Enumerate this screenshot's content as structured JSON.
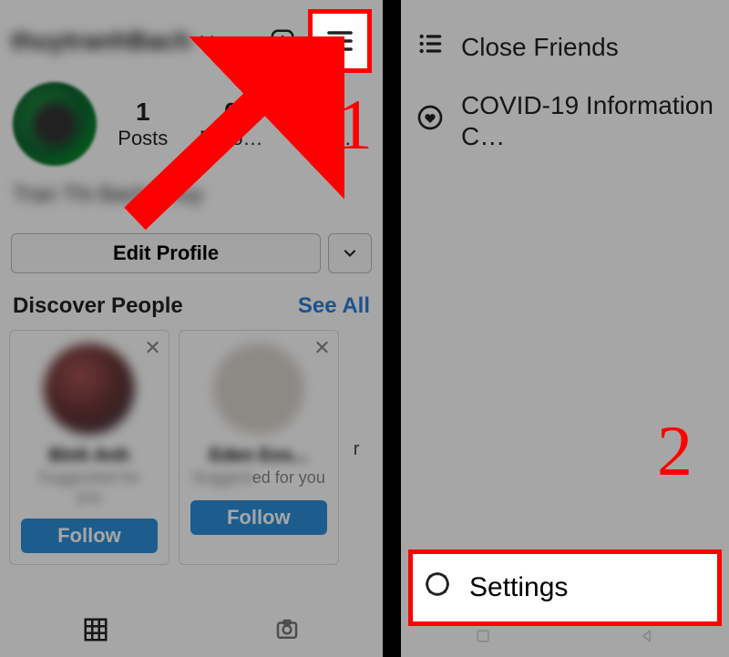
{
  "annotations": {
    "step1": "1",
    "step2": "2"
  },
  "left": {
    "username": "thuytranhBach",
    "stats": {
      "posts_num": "1",
      "posts_lbl": "Posts",
      "followers_num": "0",
      "followers_lbl": "Follo…",
      "following_num": "0",
      "following_lbl": "Follo…"
    },
    "display_name": "Tran Thi Bach Thuy",
    "edit_profile": "Edit Profile",
    "discover_title": "Discover People",
    "see_all": "See All",
    "cards": [
      {
        "name": "Binh Anh",
        "suggest_blur": "Suggested for",
        "suggest_vis": "you",
        "follow": "Follow"
      },
      {
        "name": "Eden Eos...",
        "suggest_blur": "Suggest",
        "suggest_vis": "ed for you",
        "follow": "Follow"
      }
    ],
    "card_cut_letter": "r"
  },
  "right": {
    "menu": [
      {
        "label": "Close Friends"
      },
      {
        "label": "COVID-19 Information C…"
      }
    ],
    "settings": "Settings"
  }
}
